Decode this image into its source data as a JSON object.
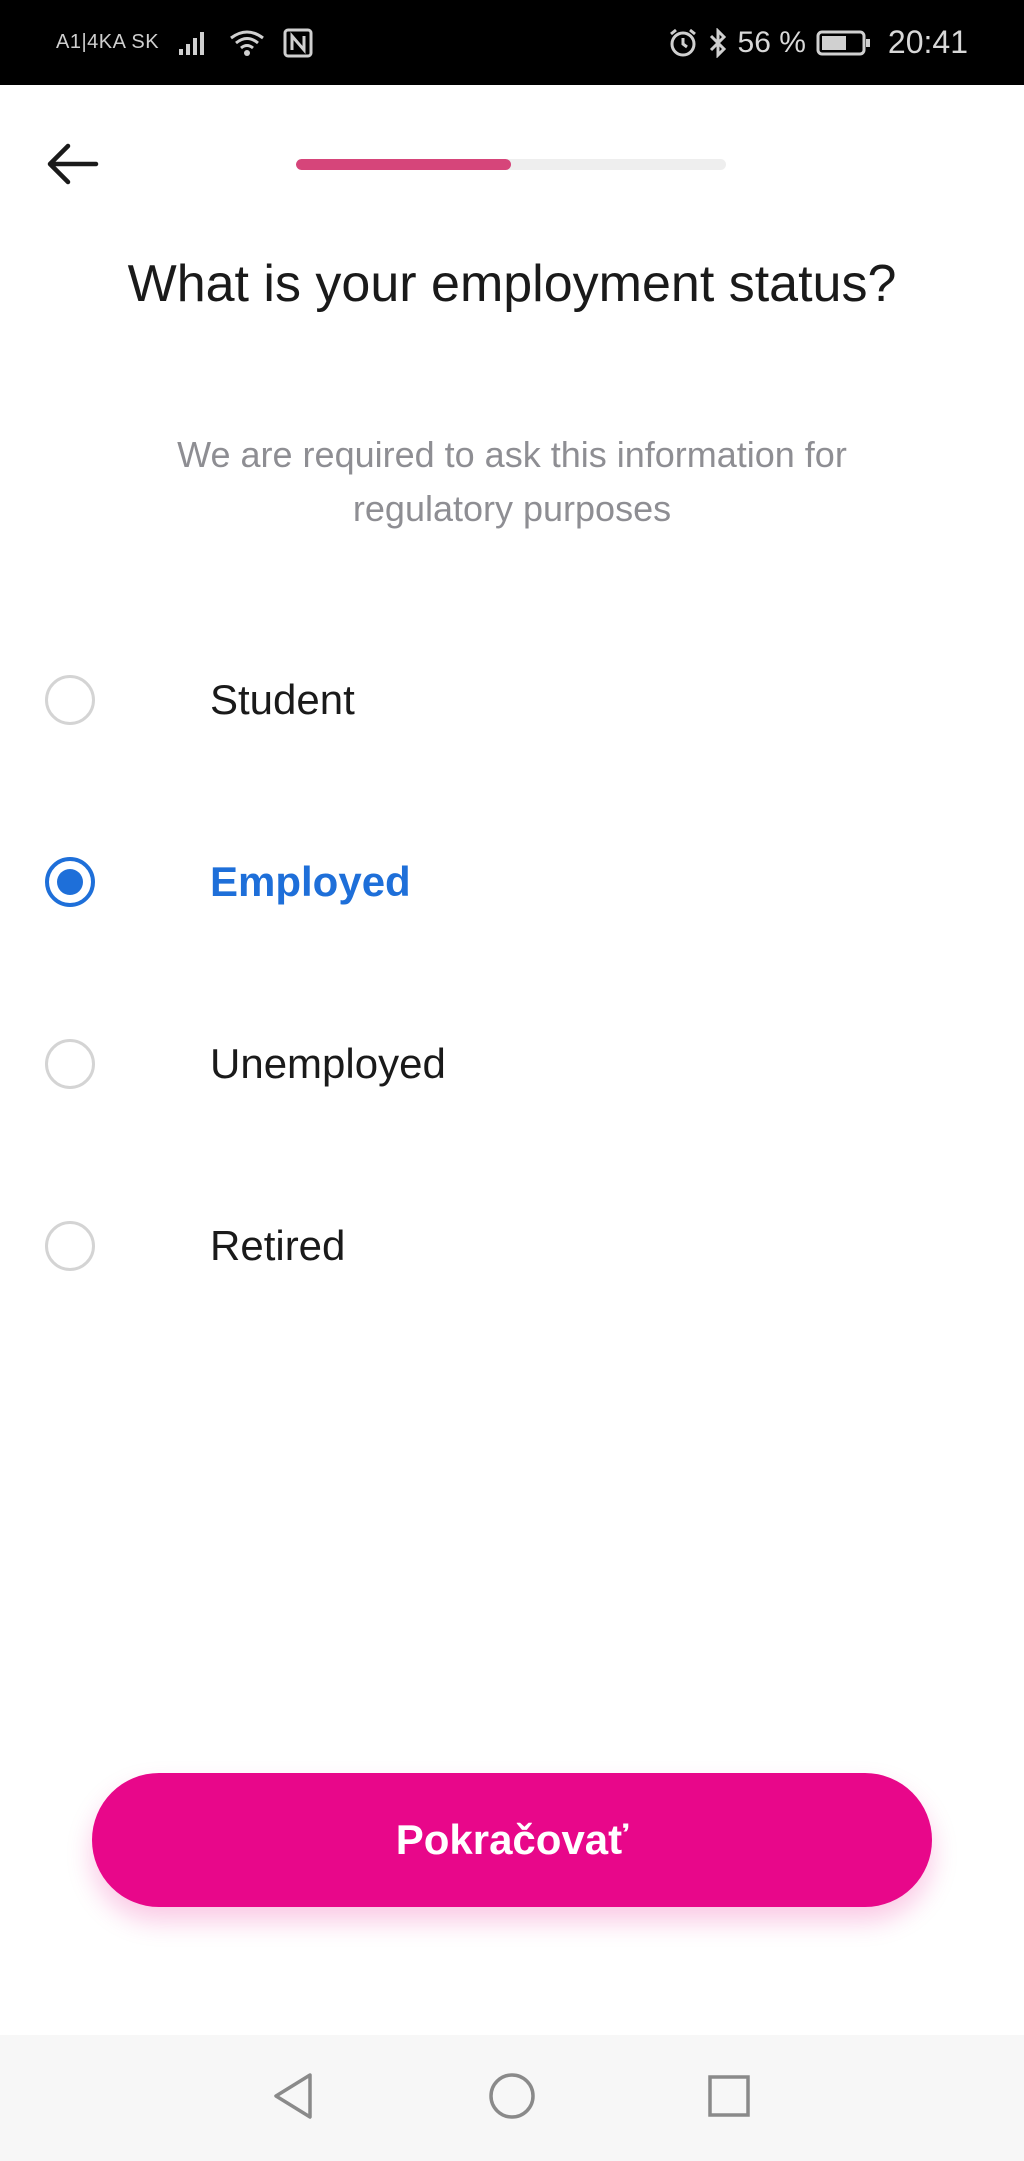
{
  "status_bar": {
    "carrier": "A1|4KA SK",
    "battery_percent": "56 %",
    "time": "20:41",
    "icons": [
      "signal-icon",
      "wifi-icon",
      "nfc-icon",
      "alarm-icon",
      "bluetooth-icon",
      "battery-icon"
    ]
  },
  "header": {
    "back_icon": "arrow-left-icon",
    "progress_fraction": 0.5
  },
  "question": {
    "title": "What is your employment status?",
    "subtitle": "We are required to ask this information for regulatory purposes"
  },
  "options": [
    {
      "label": "Student",
      "selected": false
    },
    {
      "label": "Employed",
      "selected": true
    },
    {
      "label": "Unemployed",
      "selected": false
    },
    {
      "label": "Retired",
      "selected": false
    }
  ],
  "cta": {
    "label": "Pokračovať"
  },
  "nav_bar": {
    "icons": [
      "back-triangle-icon",
      "home-circle-icon",
      "recents-square-icon"
    ]
  },
  "colors": {
    "accent_pink": "#e8078a",
    "progress_pink": "#d6457a",
    "selected_blue": "#1e6fd9"
  }
}
